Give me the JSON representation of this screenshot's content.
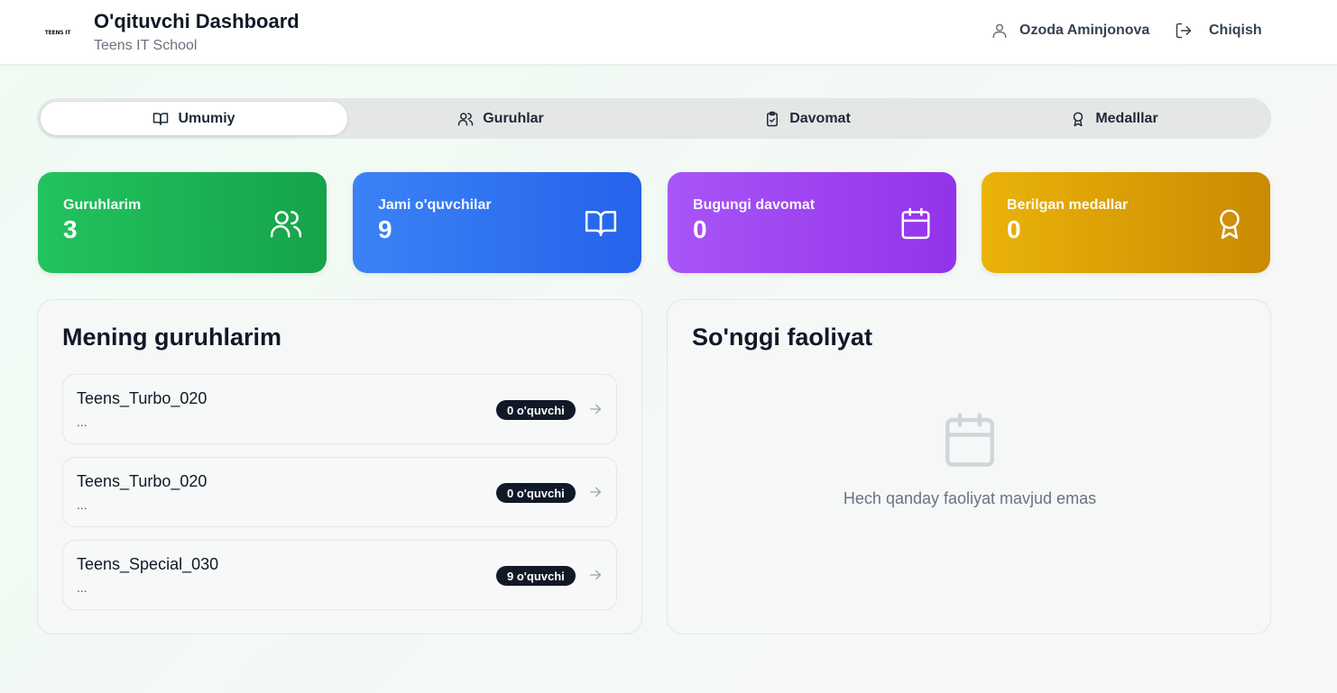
{
  "header": {
    "logo_text": "TEENS IT",
    "title": "O'qituvchi Dashboard",
    "subtitle": "Teens IT School",
    "user_name": "Ozoda Aminjonova",
    "logout_label": "Chiqish"
  },
  "tabs": [
    {
      "label": "Umumiy",
      "icon": "book-icon",
      "active": true
    },
    {
      "label": "Guruhlar",
      "icon": "users-icon",
      "active": false
    },
    {
      "label": "Davomat",
      "icon": "clipboard-check-icon",
      "active": false
    },
    {
      "label": "Medalllar",
      "icon": "award-icon",
      "active": false
    }
  ],
  "stats": [
    {
      "label": "Guruhlarim",
      "value": "3",
      "icon": "users-icon",
      "color": "#22c35e"
    },
    {
      "label": "Jami o'quvchilar",
      "value": "9",
      "icon": "book-open-icon",
      "color": "#3b82f6"
    },
    {
      "label": "Bugungi davomat",
      "value": "0",
      "icon": "calendar-icon",
      "color": "#a855f7"
    },
    {
      "label": "Berilgan medallar",
      "value": "0",
      "icon": "award-icon",
      "color": "#eab308"
    }
  ],
  "groups_panel": {
    "title": "Mening guruhlarim",
    "groups": [
      {
        "name": "Teens_Turbo_020",
        "desc": "...",
        "badge": "0 o'quvchi"
      },
      {
        "name": "Teens_Turbo_020",
        "desc": "...",
        "badge": "0 o'quvchi"
      },
      {
        "name": "Teens_Special_030",
        "desc": "...",
        "badge": "9 o'quvchi"
      }
    ]
  },
  "activity_panel": {
    "title": "So'nggi faoliyat",
    "empty_text": "Hech qanday faoliyat mavjud emas"
  }
}
